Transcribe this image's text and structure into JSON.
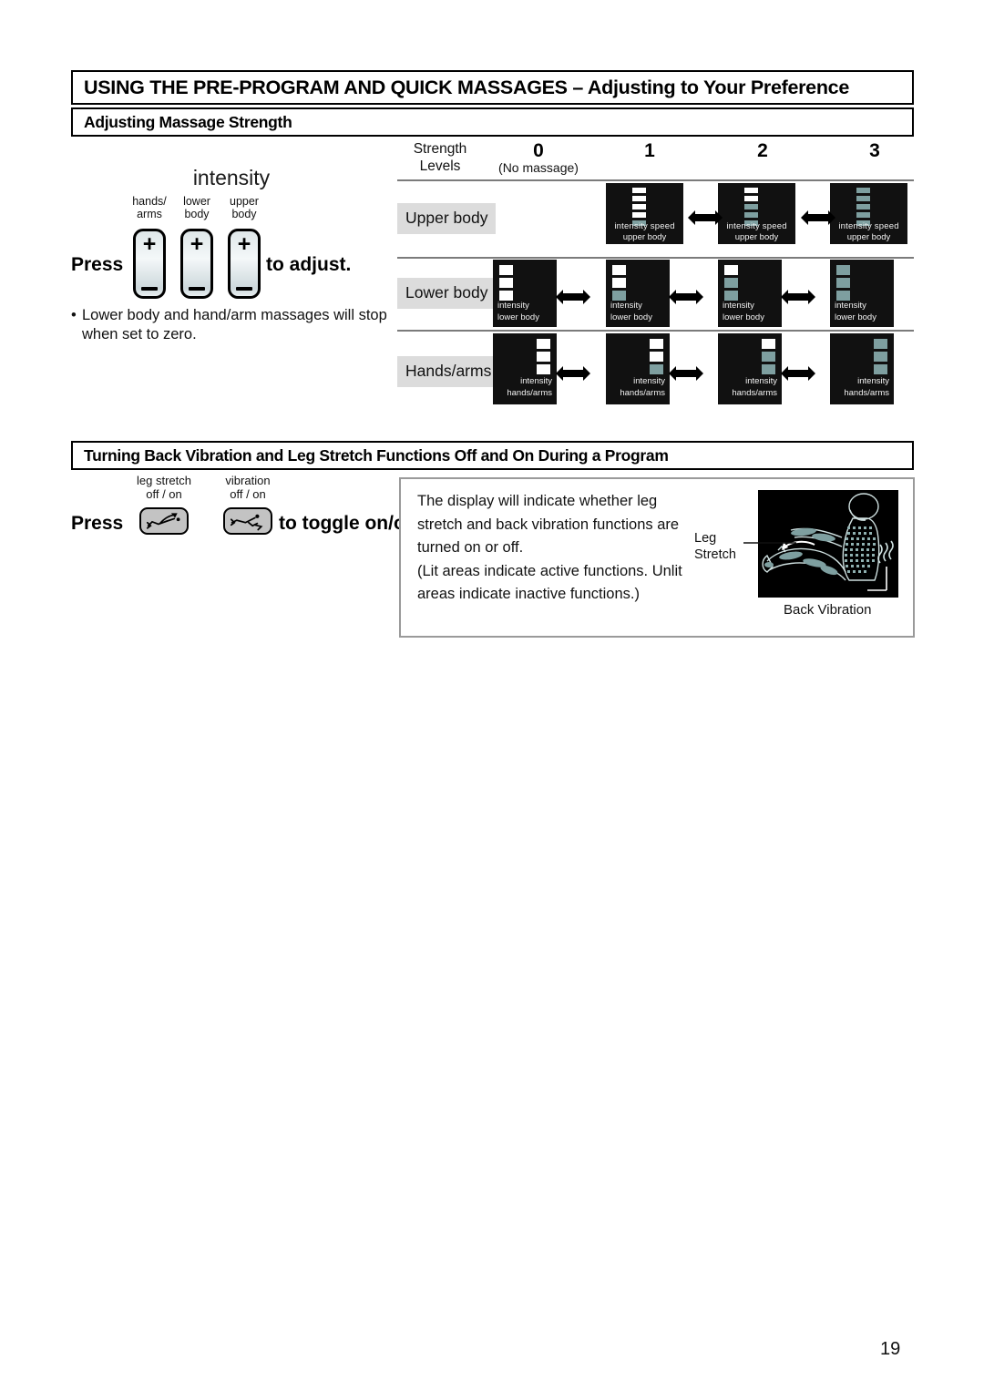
{
  "main_heading": "USING THE PRE-PROGRAM AND QUICK MASSAGES – Adjusting to Your Preference",
  "sections": {
    "strength": {
      "heading": "Adjusting Massage Strength",
      "intensity_label": "intensity",
      "press_label": "Press",
      "adjust_label": "to adjust.",
      "rockers": [
        {
          "name": "hands-arms",
          "caption_line1": "hands/",
          "caption_line2": "arms",
          "plus": "+",
          "minus": "–"
        },
        {
          "name": "lower-body",
          "caption_line1": "lower",
          "caption_line2": "body",
          "plus": "+",
          "minus": "–"
        },
        {
          "name": "upper-body",
          "caption_line1": "upper",
          "caption_line2": "body",
          "plus": "+",
          "minus": "–"
        }
      ],
      "note_bullet": "•",
      "note_text": "Lower body and hand/arm massages will stop when set to zero."
    },
    "toggle": {
      "heading": "Turning Back Vibration and Leg Stretch Functions Off and On During a Program",
      "press_label": "Press",
      "toggle_label": "to toggle on/off.",
      "buttons": [
        {
          "name": "leg-stretch",
          "caption_line1": "leg stretch",
          "caption_line2": "off / on"
        },
        {
          "name": "vibration",
          "caption_line1": "vibration",
          "caption_line2": "off / on"
        }
      ],
      "info": {
        "para1": "The display will indicate whether leg stretch and back vibration functions are turned on or off.",
        "para2": "(Lit areas indicate active functions. Unlit areas indicate inactive functions.)",
        "leg_stretch_label": "Leg Stretch",
        "back_vibration_label": "Back Vibration"
      }
    }
  },
  "matrix": {
    "row_header_label_line1": "Strength",
    "row_header_label_line2": "Levels",
    "columns": [
      {
        "num": "0",
        "sub": "(No massage)"
      },
      {
        "num": "1",
        "sub": ""
      },
      {
        "num": "2",
        "sub": ""
      },
      {
        "num": "3",
        "sub": ""
      }
    ],
    "rows": [
      {
        "label": "Upper body",
        "segment_count": 5,
        "panel_line1": "intensity  speed",
        "panel_line2": "upper body",
        "cells": [
          {
            "level": "0",
            "present": false,
            "lit": 0
          },
          {
            "level": "1",
            "present": true,
            "lit": 1
          },
          {
            "level": "2",
            "present": true,
            "lit": 3
          },
          {
            "level": "3",
            "present": true,
            "lit": 5
          }
        ]
      },
      {
        "label": "Lower body",
        "segment_count": 3,
        "panel_line1": "intensity",
        "panel_line2": "lower body",
        "cells": [
          {
            "level": "0",
            "present": true,
            "lit": 0
          },
          {
            "level": "1",
            "present": true,
            "lit": 1
          },
          {
            "level": "2",
            "present": true,
            "lit": 2
          },
          {
            "level": "3",
            "present": true,
            "lit": 3
          }
        ]
      },
      {
        "label": "Hands/arms",
        "segment_count": 3,
        "panel_line1": "intensity",
        "panel_line2": "hands/arms",
        "cells": [
          {
            "level": "0",
            "present": true,
            "lit": 0
          },
          {
            "level": "1",
            "present": true,
            "lit": 1
          },
          {
            "level": "2",
            "present": true,
            "lit": 2
          },
          {
            "level": "3",
            "present": true,
            "lit": 3
          }
        ]
      }
    ]
  },
  "colors": {
    "lit_segment": "#7e9fa0",
    "unlit_segment": "#ffffff",
    "panel_background": "#111111",
    "row_label_background": "#dcdcdc",
    "rule": "#7b7b7b"
  },
  "page_number": "19"
}
